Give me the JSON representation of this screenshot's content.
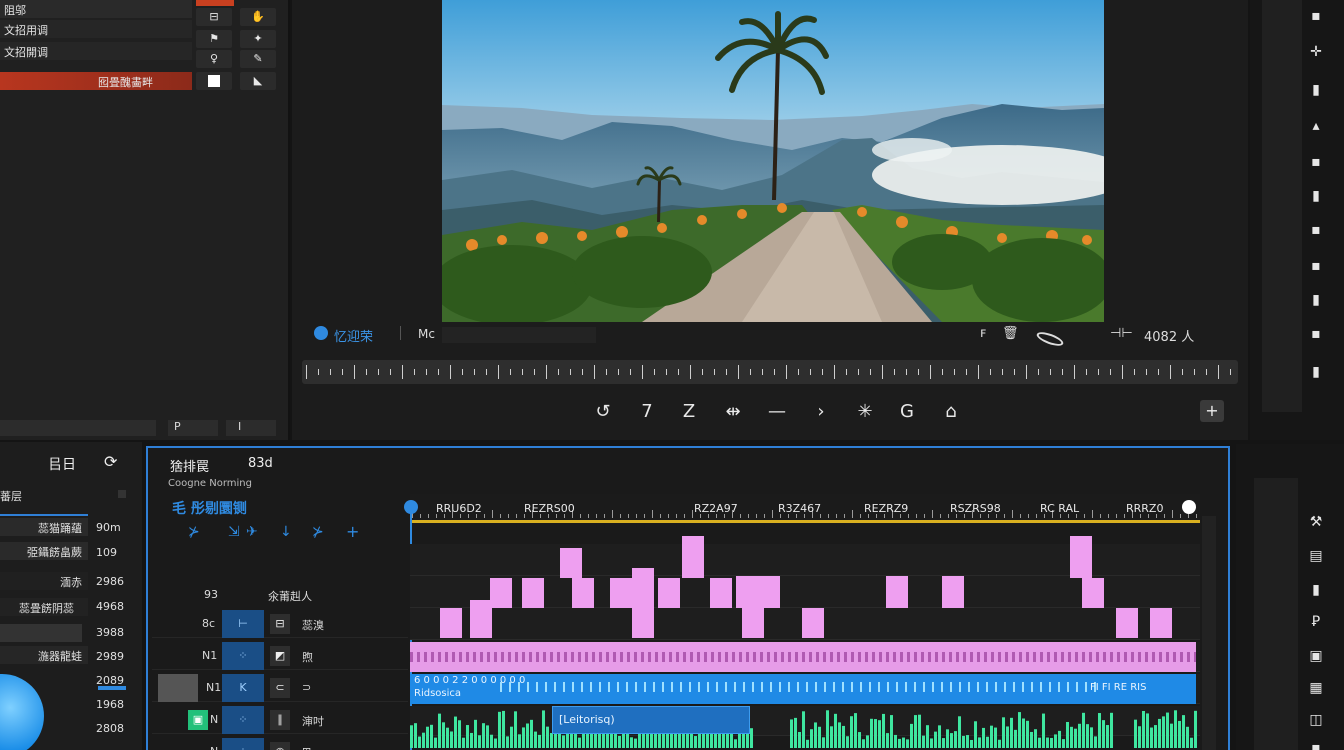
{
  "left_panel": {
    "rows": [
      "阻邬",
      "文招用调",
      "文招開调",
      "囮畳醜畵畔"
    ],
    "footer_labels": [
      "P",
      "I"
    ]
  },
  "viewer": {
    "brand": "忆迎荣",
    "mode_label": "Mc",
    "readout": "4082 人",
    "transport": [
      "↺",
      "7",
      "Z",
      "⇹",
      "—",
      "›",
      "✳",
      "G",
      "⌂"
    ],
    "add_label": "+"
  },
  "right_tools": [
    "▪",
    "✛",
    "▮",
    "▴",
    "▪",
    "▮",
    "▪",
    "▪",
    "▮",
    "▪",
    "▮",
    "▮"
  ],
  "bottom_left": {
    "header_icons": [
      "㠯日",
      "⟳"
    ],
    "section_label": "蕃层",
    "rows": [
      {
        "label": "蕊猫踊蘊",
        "value": "90m"
      },
      {
        "label": "弫鑷餝畠蕨",
        "value": "109"
      },
      {
        "label": "湎赤",
        "value": "2986"
      },
      {
        "label": "蕊畳餝阴蕊",
        "value": "4968"
      },
      {
        "label": "",
        "value": "3988"
      },
      {
        "label": "湤器龍蛙",
        "value": "2989"
      },
      {
        "label": "",
        "value": "2089"
      },
      {
        "label": "",
        "value": "1968"
      },
      {
        "label": "",
        "value": "2808"
      }
    ]
  },
  "timeline": {
    "title": "猞排罠",
    "title_right": "83d",
    "subtitle": "Coogne Norming",
    "blue_label": "毛 彤剔圜铡",
    "tool_icons": [
      "⊁",
      "⇲",
      "✈",
      "↓",
      "⊁",
      "+"
    ],
    "col_headers": [
      "93",
      "氽莆赳人"
    ],
    "timecodes": [
      "RRU6D2",
      "REZRS00",
      "RZ2A97",
      "R3Z467",
      "REZRZ9",
      "RSZRS98",
      "RC RAL",
      "RRRZ0"
    ],
    "tracks": [
      {
        "num": "8c",
        "btn": "⊢",
        "name": "蕊溴"
      },
      {
        "num": "N1",
        "btn": "⁘",
        "name": "煦"
      },
      {
        "num": "N1",
        "btn": "K",
        "name": "⊃"
      },
      {
        "num": "N",
        "btn": "⁘",
        "name": "渖吋"
      },
      {
        "num": "N",
        "btn": "⁘",
        "name": "⊞"
      }
    ],
    "video_clip_text": "6 0 0 0 2 2 0 0 0 0 0 0",
    "video_clip_text2": "Ridsosica",
    "video_clip_tail": "FI FI RE RIS",
    "audio_clip_label": "[Leitorisq)",
    "colors": {
      "pink": "#ee9ff0",
      "blue": "#1f8ae6",
      "green": "#3fe6a0",
      "accent": "#2f7fd6"
    }
  }
}
